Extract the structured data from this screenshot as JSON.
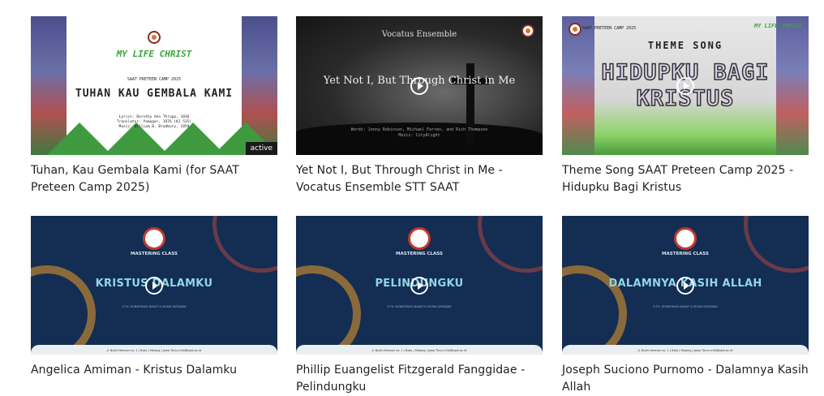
{
  "videos": [
    {
      "title": "Tuhan, Kau Gembala Kami (for SAAT Preteen Camp 2025)",
      "badge": "active",
      "thumb": {
        "brand": "MY LIFE CHRIST",
        "sub": "SAAT PRETEEN CAMP 2025",
        "heading": "TUHAN KAU GEMBALA KAMI",
        "credits": [
          "Lyrics: Dorothy Ann Thrupp, 1836",
          "Translator: Yamuger, 1976 (KJ 535)",
          "Music: William B. Bradbury, 1859"
        ]
      }
    },
    {
      "title": "Yet Not I, But Through Christ in Me - Vocatus Ensemble STT SAAT",
      "thumb": {
        "ensemble": "Vocatus Ensemble",
        "song": "Yet Not I, But Through Christ in Me",
        "words": [
          "Words: Jonny Robinson, Michael Farren, and Rich Thompson",
          "Music: CityAlight"
        ]
      }
    },
    {
      "title": "Theme Song SAAT Preteen Camp 2025 - Hidupku Bagi Kristus",
      "thumb": {
        "header": "SAAT PRETEEN CAMP 2025",
        "brand": "MY LIFE CHRIST",
        "label": "THEME SONG",
        "line1": "HIDUPKU BAGI",
        "line2": "KRISTUS"
      }
    },
    {
      "title": "Angelica Amiman - Kristus Dalamku",
      "thumb": {
        "class_label": "MASTERING CLASS",
        "song": "KRISTUS DALAMKU",
        "small": "S.TH. KONSERVASI BAKAT & MUSIK GEREJAWI",
        "footer": "Jl. Bukit Hermon no. 1 | Batu | Malang | Jawa Timur     info@saat.ac.id"
      }
    },
    {
      "title": "Phillip Euangelist Fitzgerald Fanggidae - Pelindungku",
      "thumb": {
        "class_label": "MASTERING CLASS",
        "song": "PELINDUNGKU",
        "small": "S.TH. KONSERVASI BAKAT & MUSIK GEREJAWI",
        "footer": "Jl. Bukit Hermon no. 1 | Batu | Malang | Jawa Timur     info@saat.ac.id"
      }
    },
    {
      "title": "Joseph Suciono Purnomo - Dalamnya Kasih Allah",
      "thumb": {
        "class_label": "MASTERING CLASS",
        "song": "DALAMNYA KASIH ALLAH",
        "small": "S.TH. KONSERVASI BAKAT & MUSIK GEREJAWI",
        "footer": "Jl. Bukit Hermon no. 1 | Batu | Malang | Jawa Timur     info@saat.ac.id"
      }
    }
  ],
  "colors": {
    "accent_green": "#3aa53a",
    "navy": "#142d52",
    "title_text": "#222222"
  }
}
